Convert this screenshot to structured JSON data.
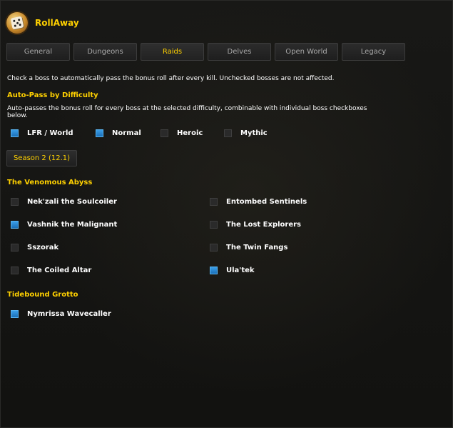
{
  "app": {
    "title": "RollAway",
    "logo_icon": "dice-icon"
  },
  "tabs": [
    {
      "label": "General",
      "active": false
    },
    {
      "label": "Dungeons",
      "active": false
    },
    {
      "label": "Raids",
      "active": true
    },
    {
      "label": "Delves",
      "active": false
    },
    {
      "label": "Open World",
      "active": false
    },
    {
      "label": "Legacy",
      "active": false
    }
  ],
  "intro": "Check a boss to automatically pass the bonus roll after every kill. Unchecked bosses are not affected.",
  "difficulty": {
    "title": "Auto-Pass by Difficulty",
    "desc_line1": "Auto-passes the bonus roll for every boss at the selected difficulty, combinable with individual boss checkboxes",
    "desc_line2": "below.",
    "options": [
      {
        "label": "LFR / World",
        "checked": true
      },
      {
        "label": "Normal",
        "checked": true
      },
      {
        "label": "Heroic",
        "checked": false
      },
      {
        "label": "Mythic",
        "checked": false
      }
    ]
  },
  "season_button": "Season 2 (12.1)",
  "raids": [
    {
      "name": "The Venomous Abyss",
      "bosses": [
        {
          "label": "Nek'zali the Soulcoiler",
          "checked": false
        },
        {
          "label": "Entombed Sentinels",
          "checked": false
        },
        {
          "label": "Vashnik the Malignant",
          "checked": true
        },
        {
          "label": "The Lost Explorers",
          "checked": false
        },
        {
          "label": "Sszorak",
          "checked": false
        },
        {
          "label": "The Twin Fangs",
          "checked": false
        },
        {
          "label": "The Coiled Altar",
          "checked": false
        },
        {
          "label": "Ula'tek",
          "checked": true
        }
      ]
    },
    {
      "name": "Tidebound Grotto",
      "bosses": [
        {
          "label": "Nymrissa Wavecaller",
          "checked": true
        }
      ]
    }
  ],
  "colors": {
    "accent": "#ffd100",
    "checkbox_checked": "#2a86d4",
    "text": "#ffffff"
  }
}
